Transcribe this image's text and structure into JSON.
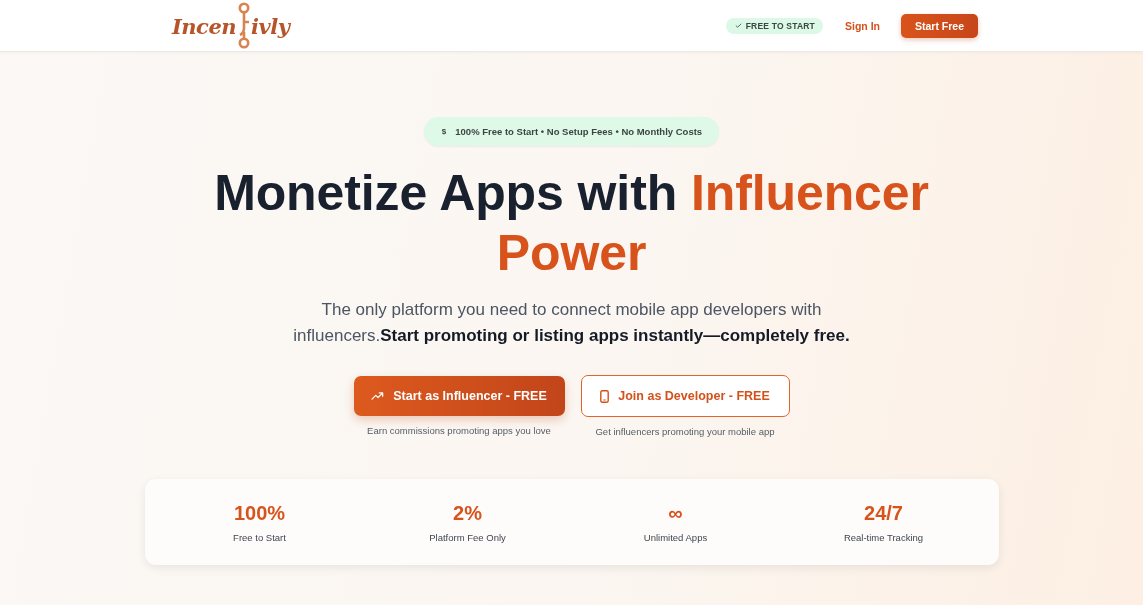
{
  "nav": {
    "logo": {
      "before": "Incen",
      "after": "ivly"
    },
    "badge": {
      "label": "FREE TO START"
    },
    "links": [
      {
        "label": "Sign In",
        "kind": "link"
      },
      {
        "label": "Start Free",
        "kind": "button"
      }
    ]
  },
  "hero": {
    "badge": {
      "icon": "$",
      "text": "100% Free to Start • No Setup Fees • No Monthly Costs"
    },
    "title": [
      {
        "text": "Monetize Apps with",
        "accent": false
      },
      {
        "text": "Influencer Power",
        "accent": true
      }
    ],
    "subtitle": "The only platform you need to connect mobile app developers with influencers.**Start promoting or listing apps instantly—completely free.**",
    "actions": [
      {
        "kind": "primary",
        "label": "Start as Influencer - FREE",
        "caption": "Earn commissions promoting apps you love"
      },
      {
        "kind": "secondary",
        "label": "Join as Developer - FREE",
        "caption": "Get influencers promoting your mobile app"
      }
    ]
  },
  "stats": [
    {
      "value": "100%",
      "label": "Free to Start"
    },
    {
      "value": "2%",
      "label": "Platform Fee Only"
    },
    {
      "value": "∞",
      "label": "Unlimited Apps"
    },
    {
      "value": "24/7",
      "label": "Real-time Tracking"
    }
  ]
}
